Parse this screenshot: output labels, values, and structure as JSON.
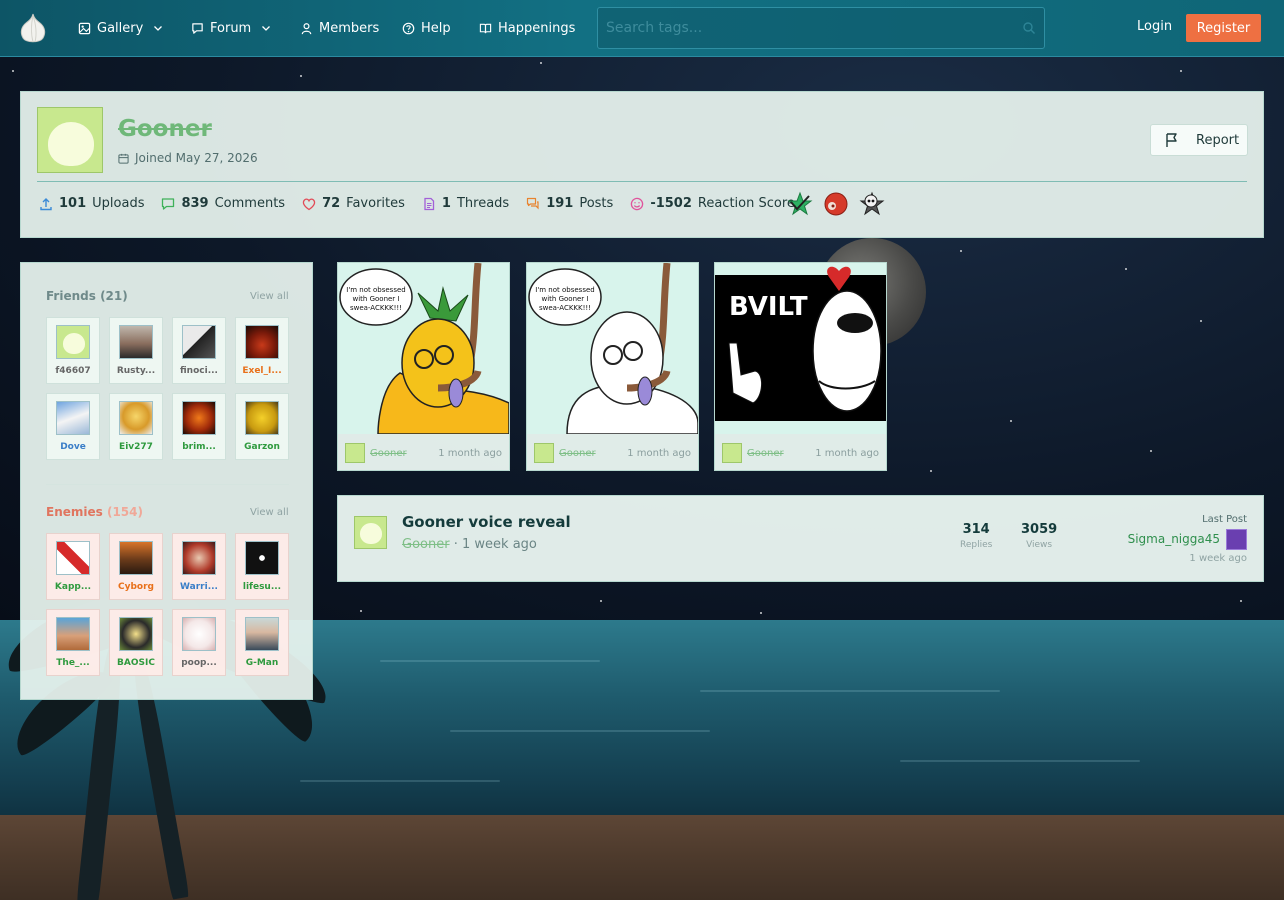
{
  "nav": {
    "gallery": "Gallery",
    "forum": "Forum",
    "members": "Members",
    "help": "Help",
    "happenings": "Happenings",
    "search_placeholder": "Search tags...",
    "login": "Login",
    "register": "Register"
  },
  "profile": {
    "username": "Gooner",
    "joined": "Joined May 27, 2026",
    "report": "Report",
    "stats": [
      {
        "value": "101",
        "label": "Uploads"
      },
      {
        "value": "839",
        "label": "Comments"
      },
      {
        "value": "72",
        "label": "Favorites"
      },
      {
        "value": "1",
        "label": "Threads"
      },
      {
        "value": "191",
        "label": "Posts"
      },
      {
        "value": "-1502",
        "label": "Reaction Score"
      }
    ]
  },
  "friends": {
    "title": "Friends",
    "count": "(21)",
    "view_all": "View all",
    "items": [
      {
        "name": "f46607",
        "color": "#666666"
      },
      {
        "name": "Rusty...",
        "color": "#666666"
      },
      {
        "name": "finoci...",
        "color": "#666666"
      },
      {
        "name": "Exel_I...",
        "color": "#e8701a"
      },
      {
        "name": "Dove",
        "color": "#3a7ec8"
      },
      {
        "name": "Eiv277",
        "color": "#2e9a3e"
      },
      {
        "name": "brim...",
        "color": "#2e9a3e"
      },
      {
        "name": "Garzon",
        "color": "#2e9a3e"
      }
    ]
  },
  "enemies": {
    "title": "Enemies",
    "count": "(154)",
    "view_all": "View all",
    "items": [
      {
        "name": "Kapp...",
        "color": "#2e9a3e"
      },
      {
        "name": "Cyborg",
        "color": "#e8701a"
      },
      {
        "name": "Warri...",
        "color": "#3a7ec8"
      },
      {
        "name": "lifesu...",
        "color": "#2e9a3e"
      },
      {
        "name": "The_...",
        "color": "#2e9a3e"
      },
      {
        "name": "BAOSIC",
        "color": "#2e9a3e"
      },
      {
        "name": "poop...",
        "color": "#666666"
      },
      {
        "name": "G-Man",
        "color": "#2e9a3e"
      }
    ]
  },
  "gallery": [
    {
      "user": "Gooner",
      "time": "1 month ago",
      "caption": "I'm not obsessed with Gooner I swea-ACKKK!!!"
    },
    {
      "user": "Gooner",
      "time": "1 month ago",
      "caption": "I'm not obsessed with Gooner I swea-ACKKK!!!"
    },
    {
      "user": "Gooner",
      "time": "1 month ago",
      "caption": "BVILT"
    }
  ],
  "thread": {
    "title": "Gooner voice reveal",
    "user": "Gooner",
    "sep": "·",
    "time": "1 week ago",
    "replies": "314",
    "replies_label": "Replies",
    "views": "3059",
    "views_label": "Views",
    "last_post_label": "Last Post",
    "last_post_user": "Sigma_nigga45",
    "last_post_time": "1 week ago"
  },
  "colors": {
    "navbar": "#127083",
    "register": "#ee7042",
    "panel": "#e9f5f0",
    "username": "#6fb879"
  }
}
